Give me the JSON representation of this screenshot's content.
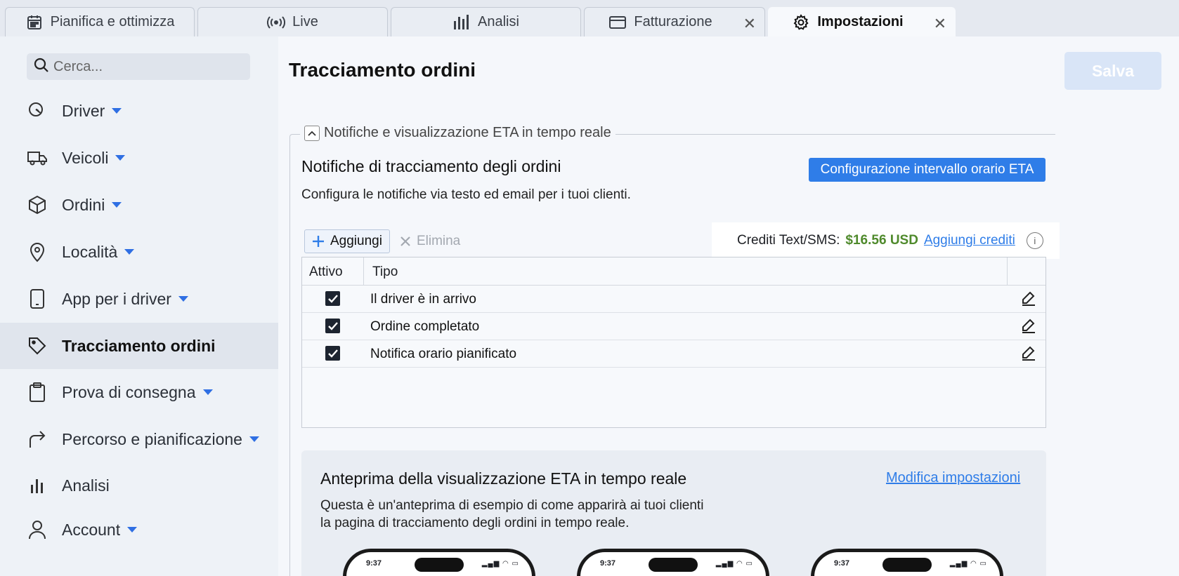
{
  "tabs": [
    {
      "label": "Pianifica e ottimizza",
      "icon": "calendar-icon",
      "closable": false,
      "active": false
    },
    {
      "label": "Live",
      "icon": "broadcast-icon",
      "closable": false,
      "active": false
    },
    {
      "label": "Analisi",
      "icon": "bar-chart-icon",
      "closable": false,
      "active": false
    },
    {
      "label": "Fatturazione",
      "icon": "credit-card-icon",
      "closable": true,
      "active": false
    },
    {
      "label": "Impostazioni",
      "icon": "gear-icon",
      "closable": true,
      "active": true
    }
  ],
  "sidebar": {
    "search_placeholder": "Cerca...",
    "items": [
      {
        "label": "Driver",
        "icon": "driver-icon",
        "expandable": true
      },
      {
        "label": "Veicoli",
        "icon": "truck-icon",
        "expandable": true
      },
      {
        "label": "Ordini",
        "icon": "package-icon",
        "expandable": true
      },
      {
        "label": "Località",
        "icon": "location-pin-icon",
        "expandable": true
      },
      {
        "label": "App per i driver",
        "icon": "phone-icon",
        "expandable": true
      },
      {
        "label": "Tracciamento ordini",
        "icon": "tag-icon",
        "expandable": false,
        "active": true
      },
      {
        "label": "Prova di consegna",
        "icon": "clipboard-icon",
        "expandable": true
      },
      {
        "label": "Percorso e pianificazione",
        "icon": "route-arrow-icon",
        "expandable": true
      },
      {
        "label": "Analisi",
        "icon": "bar-chart-icon",
        "expandable": false
      },
      {
        "label": "Account",
        "icon": "user-icon",
        "expandable": true
      }
    ]
  },
  "main": {
    "title": "Tracciamento ordini",
    "save_label": "Salva",
    "section_legend": "Notifiche e visualizzazione ETA in tempo reale",
    "notifications": {
      "title": "Notifiche di tracciamento degli ordini",
      "subtitle": "Configura le notifiche via testo ed email per i tuoi clienti.",
      "eta_button": "Configurazione intervallo orario ETA",
      "add_label": "Aggiungi",
      "delete_label": "Elimina",
      "credits_label": "Crediti Text/SMS:",
      "credits_amount": "$16.56 USD",
      "credits_link": "Aggiungi crediti",
      "columns": {
        "active": "Attivo",
        "type": "Tipo"
      },
      "rows": [
        {
          "label": "Il driver è in arrivo",
          "checked": true
        },
        {
          "label": "Ordine completato",
          "checked": true
        },
        {
          "label": "Notifica orario pianificato",
          "checked": true
        }
      ]
    },
    "preview": {
      "title": "Anteprima della visualizzazione ETA in tempo reale",
      "link": "Modifica impostazioni",
      "desc_line1": "Questa è un'anteprima di esempio di come apparirà ai tuoi clienti",
      "desc_line2": "la pagina di tracciamento degli ordini in tempo reale.",
      "phone_time": "9:37"
    }
  },
  "colors": {
    "accent": "#2f7de8",
    "credit_green": "#4f8a2c",
    "caret": "#2f6fe3"
  }
}
